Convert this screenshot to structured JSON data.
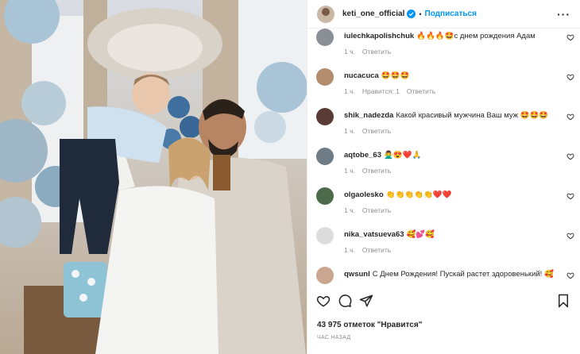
{
  "post": {
    "username": "keti_one_official",
    "separator": "•",
    "follow_label": "Подписаться",
    "more_label": "···",
    "likes": "43 975 отметок \"Нравится\"",
    "posted_time": "ЧАС НАЗАД",
    "photo_alt": "photo"
  },
  "colors": {
    "accent": "#0095f6",
    "muted": "#8e8e8e",
    "text": "#262626"
  },
  "comments": [
    {
      "user": "iulechkapolishchuk",
      "text": "🔥🔥🔥🤩с днем рождения Адам",
      "time": "1 ч.",
      "likes": "",
      "reply": "Ответить",
      "avatar_color": "#8a8f95"
    },
    {
      "user": "nucacuca",
      "text": "🤩🤩🤩",
      "time": "1 ч.",
      "likes": "Нравится: 1",
      "reply": "Ответить",
      "avatar_color": "#b38b6d"
    },
    {
      "user": "shik_nadezda",
      "text": "Какой красивый мужчина Ваш муж 🤩🤩🤩",
      "time": "1 ч.",
      "likes": "",
      "reply": "Ответить",
      "avatar_color": "#5a3b35"
    },
    {
      "user": "aqtobe_63",
      "text": "🙅‍♂️😍❤️🙏",
      "time": "1 ч.",
      "likes": "",
      "reply": "Ответить",
      "avatar_color": "#6f7c85"
    },
    {
      "user": "olgaolesko",
      "text": "👏👏👏👏👏❤️❤️",
      "time": "1 ч.",
      "likes": "",
      "reply": "Ответить",
      "avatar_color": "#4d6a4a"
    },
    {
      "user": "nika_vatsueva63",
      "text": "🥰💕🥰",
      "time": "1 ч.",
      "likes": "",
      "reply": "Ответить",
      "avatar_color": "#dcdcdc"
    },
    {
      "user": "qwsunl",
      "text": "С Днем Рождения! Пускай растет здорове​нький! 🥰",
      "time": "",
      "likes": "",
      "reply": "",
      "avatar_color": "#caa58f"
    }
  ]
}
